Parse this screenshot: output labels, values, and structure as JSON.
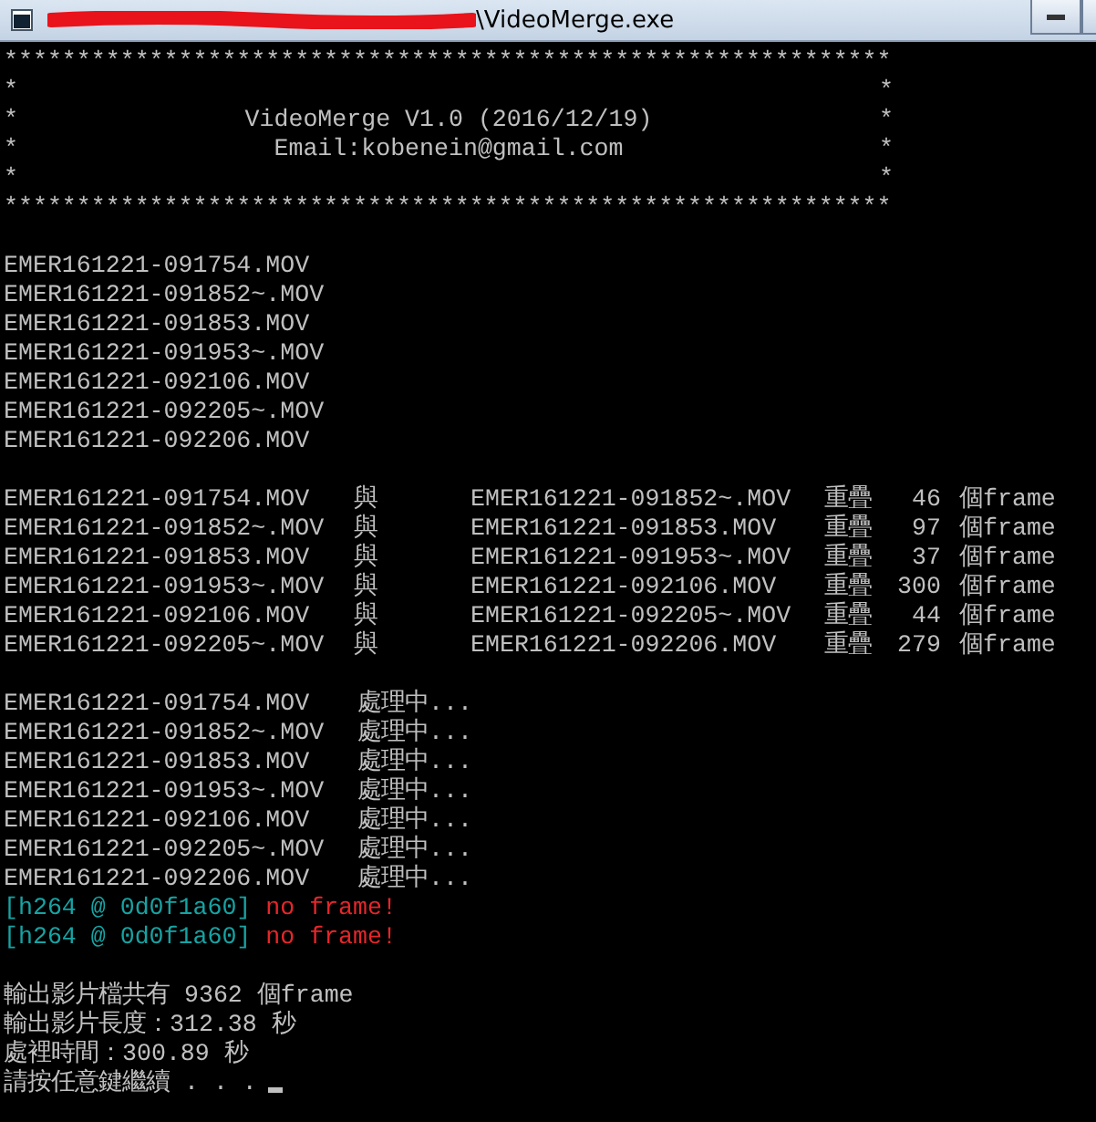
{
  "window": {
    "title": "\\VideoMerge.exe"
  },
  "banner": {
    "border_top": "*************************************************************",
    "rows": [
      {
        "left": "*",
        "text": "",
        "right": "*"
      },
      {
        "left": "*",
        "text": "VideoMerge V1.0 (2016/12/19)",
        "right": "*"
      },
      {
        "left": "*",
        "text": "Email:kobenein@gmail.com",
        "right": "*"
      },
      {
        "left": "*",
        "text": "",
        "right": "*"
      }
    ],
    "border_bottom": "*************************************************************"
  },
  "files": [
    "EMER161221-091754.MOV",
    "EMER161221-091852~.MOV",
    "EMER161221-091853.MOV",
    "EMER161221-091953~.MOV",
    "EMER161221-092106.MOV",
    "EMER161221-092205~.MOV",
    "EMER161221-092206.MOV"
  ],
  "overlaps": [
    {
      "first": "EMER161221-091754.MOV",
      "with": "與",
      "second": "EMER161221-091852~.MOV",
      "label": "重疊",
      "count": "46",
      "unit": "個frame"
    },
    {
      "first": "EMER161221-091852~.MOV",
      "with": "與",
      "second": "EMER161221-091853.MOV",
      "label": "重疊",
      "count": "97",
      "unit": "個frame"
    },
    {
      "first": "EMER161221-091853.MOV",
      "with": "與",
      "second": "EMER161221-091953~.MOV",
      "label": "重疊",
      "count": "37",
      "unit": "個frame"
    },
    {
      "first": "EMER161221-091953~.MOV",
      "with": "與",
      "second": "EMER161221-092106.MOV",
      "label": "重疊",
      "count": "300",
      "unit": "個frame"
    },
    {
      "first": "EMER161221-092106.MOV",
      "with": "與",
      "second": "EMER161221-092205~.MOV",
      "label": "重疊",
      "count": "44",
      "unit": "個frame"
    },
    {
      "first": "EMER161221-092205~.MOV",
      "with": "與",
      "second": "EMER161221-092206.MOV",
      "label": "重疊",
      "count": "279",
      "unit": "個frame"
    }
  ],
  "processing": [
    {
      "file": "EMER161221-091754.MOV",
      "status": "處理中..."
    },
    {
      "file": "EMER161221-091852~.MOV",
      "status": "處理中..."
    },
    {
      "file": "EMER161221-091853.MOV",
      "status": "處理中..."
    },
    {
      "file": "EMER161221-091953~.MOV",
      "status": "處理中..."
    },
    {
      "file": "EMER161221-092106.MOV",
      "status": "處理中..."
    },
    {
      "file": "EMER161221-092205~.MOV",
      "status": "處理中..."
    },
    {
      "file": "EMER161221-092206.MOV",
      "status": "處理中..."
    }
  ],
  "errors": [
    {
      "source": "[h264 @ 0d0f1a60]",
      "message": "no frame!"
    },
    {
      "source": "[h264 @ 0d0f1a60]",
      "message": "no frame!"
    }
  ],
  "summary": [
    "輸出影片檔共有 9362 個frame",
    "輸出影片長度：312.38 秒",
    "處裡時間：300.89 秒",
    "請按任意鍵繼續 . . ."
  ]
}
